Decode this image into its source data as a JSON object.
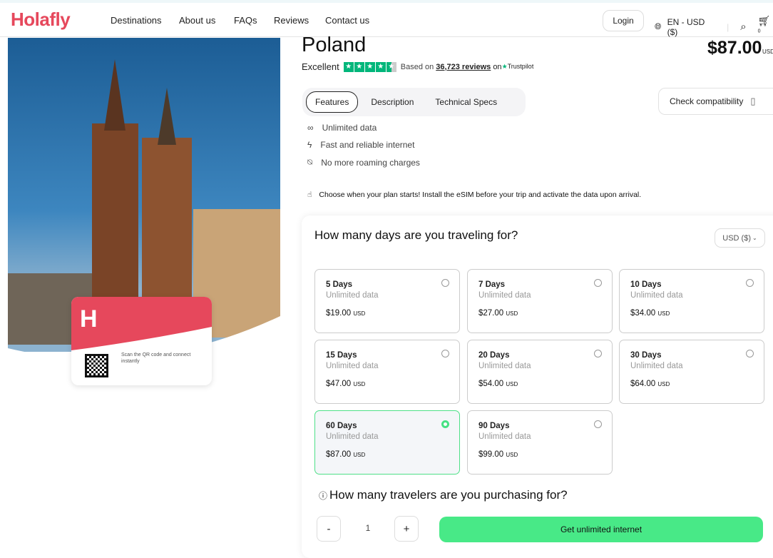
{
  "header": {
    "logo": "Holafly",
    "nav": [
      "Destinations",
      "About us",
      "FAQs",
      "Reviews",
      "Contact us"
    ],
    "login": "Login",
    "language": "EN - USD ($)",
    "cart_count": "0"
  },
  "product": {
    "title": "Poland",
    "price": "$87.00",
    "price_unit": "USD",
    "rating_label": "Excellent",
    "based_on": "Based on",
    "reviews": "36,723 reviews",
    "on": "on",
    "trustpilot": "Trustpilot",
    "stars": 4.5
  },
  "esim_card": {
    "logo": "H",
    "text": "Scan the QR code and connect instantly"
  },
  "tabs": [
    "Features",
    "Description",
    "Technical Specs"
  ],
  "check_compatibility": "Check compatibility",
  "features": [
    "Unlimited data",
    "Fast and reliable internet",
    "No more roaming charges"
  ],
  "note": "Choose when your plan starts! Install the eSIM before your trip and activate the data upon arrival.",
  "plans_section": {
    "question": "How many days are you traveling for?",
    "currency": "USD ($)",
    "plans": [
      {
        "days": "5 Days",
        "data": "Unlimited data",
        "price": "$19.00",
        "unit": "USD",
        "selected": false
      },
      {
        "days": "7 Days",
        "data": "Unlimited data",
        "price": "$27.00",
        "unit": "USD",
        "selected": false
      },
      {
        "days": "10 Days",
        "data": "Unlimited data",
        "price": "$34.00",
        "unit": "USD",
        "selected": false
      },
      {
        "days": "15 Days",
        "data": "Unlimited data",
        "price": "$47.00",
        "unit": "USD",
        "selected": false
      },
      {
        "days": "20 Days",
        "data": "Unlimited data",
        "price": "$54.00",
        "unit": "USD",
        "selected": false
      },
      {
        "days": "30 Days",
        "data": "Unlimited data",
        "price": "$64.00",
        "unit": "USD",
        "selected": false
      },
      {
        "days": "60 Days",
        "data": "Unlimited data",
        "price": "$87.00",
        "unit": "USD",
        "selected": true
      },
      {
        "days": "90 Days",
        "data": "Unlimited data",
        "price": "$99.00",
        "unit": "USD",
        "selected": false
      }
    ]
  },
  "travelers": {
    "question": "How many travelers are you purchasing for?",
    "minus": "-",
    "quantity": "1",
    "plus": "+"
  },
  "cta": "Get unlimited internet"
}
